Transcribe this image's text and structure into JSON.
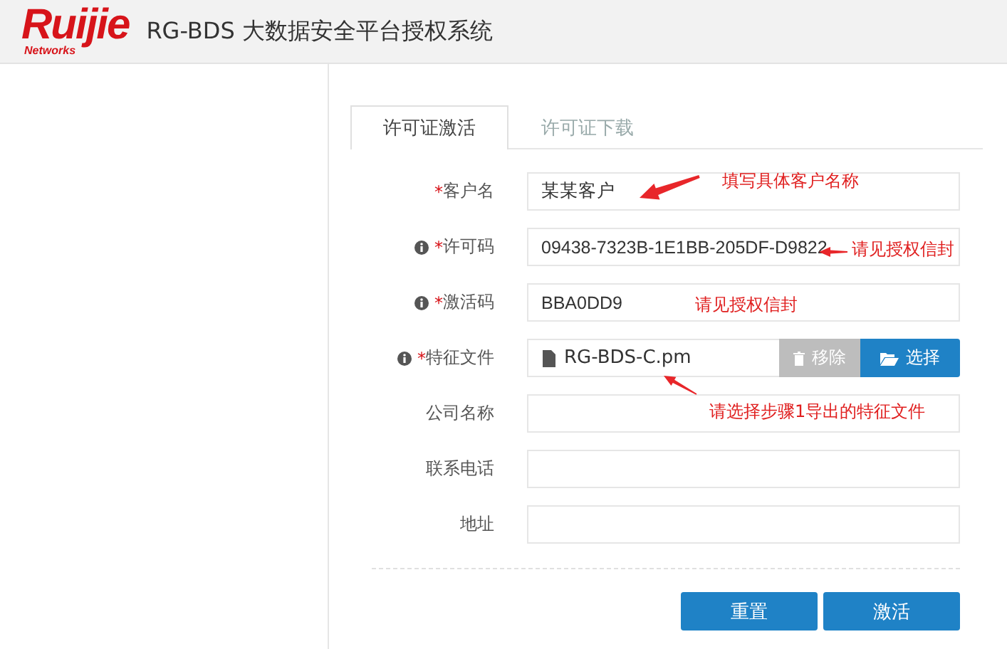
{
  "header": {
    "logo": {
      "wordmark": "Ruijie",
      "tagline": "Networks"
    },
    "title": "RG-BDS 大数据安全平台授权系统"
  },
  "tabs": [
    {
      "label": "许可证激活",
      "selected": true
    },
    {
      "label": "许可证下载",
      "selected": false
    }
  ],
  "form": {
    "fields": [
      {
        "kind": "text",
        "label": "客户名",
        "asterisk": "*",
        "info": false,
        "value": "某某客户"
      },
      {
        "kind": "text",
        "label": "许可码",
        "asterisk": "*",
        "info": true,
        "value": "09438-7323B-1E1BB-205DF-D9822"
      },
      {
        "kind": "text",
        "label": "激活码",
        "asterisk": "*",
        "info": true,
        "value": "BBA0DD9"
      },
      {
        "kind": "file",
        "label": "特征文件",
        "asterisk": "*",
        "info": true,
        "value": "RG-BDS-C.pm",
        "remove": {
          "label": "移除",
          "disabled": true
        },
        "choose": {
          "label": "选择"
        }
      },
      {
        "kind": "text",
        "label": "公司名称",
        "info": false
      },
      {
        "kind": "text",
        "label": "联系电话",
        "info": false
      },
      {
        "kind": "text",
        "label": "地址",
        "info": false
      }
    ],
    "buttons": [
      "重置",
      "激活"
    ]
  },
  "annotations": [
    {
      "text": "填写具体客户名称",
      "arrow": true
    },
    {
      "text": "请见授权信封",
      "arrow": true
    },
    {
      "text": "请见授权信封",
      "arrow": false
    },
    {
      "text": "请选择步骤1导出的特征文件",
      "arrow": true
    }
  ]
}
